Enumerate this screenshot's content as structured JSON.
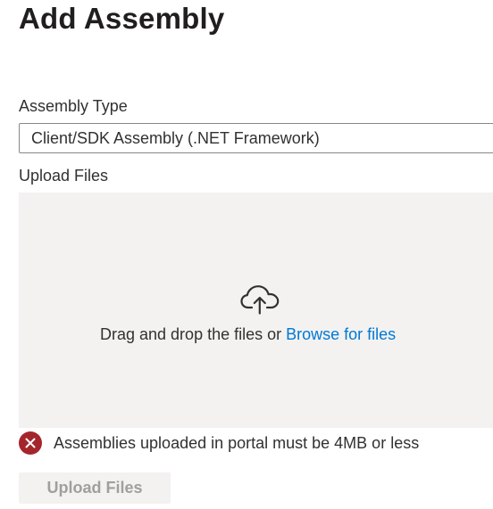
{
  "page": {
    "title": "Add Assembly"
  },
  "assembly_type": {
    "label": "Assembly Type",
    "selected_value": "Client/SDK Assembly (.NET Framework)"
  },
  "upload": {
    "label": "Upload Files",
    "drop_text": "Drag and drop the files or ",
    "browse_link": "Browse for files",
    "icon": "cloud-upload-icon"
  },
  "error": {
    "icon": "error-circle-icon",
    "message": "Assemblies uploaded in portal must be 4MB or less",
    "color": "#a4262c"
  },
  "actions": {
    "upload_button": "Upload Files",
    "upload_button_disabled": true
  },
  "colors": {
    "link": "#0078d4",
    "dropzone_bg": "#f3f2f1",
    "disabled_text": "#a19f9d"
  }
}
